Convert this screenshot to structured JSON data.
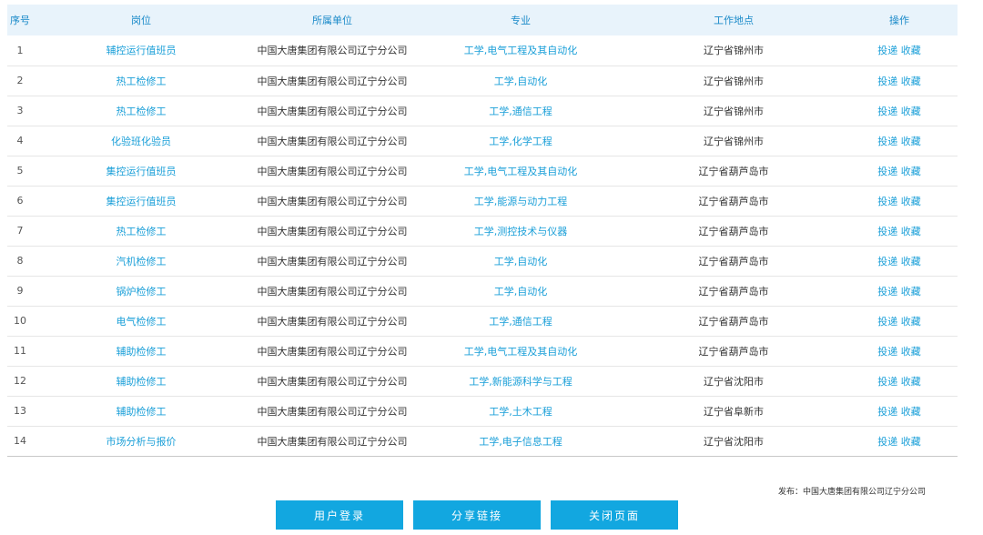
{
  "table": {
    "headers": [
      "序号",
      "岗位",
      "所属单位",
      "专业",
      "工作地点",
      "操作"
    ],
    "rows": [
      {
        "no": "1",
        "position": "辅控运行值班员",
        "unit": "中国大唐集团有限公司辽宁分公司",
        "major": "工学,电气工程及其自动化",
        "location": "辽宁省锦州市"
      },
      {
        "no": "2",
        "position": "热工检修工",
        "unit": "中国大唐集团有限公司辽宁分公司",
        "major": "工学,自动化",
        "location": "辽宁省锦州市"
      },
      {
        "no": "3",
        "position": "热工检修工",
        "unit": "中国大唐集团有限公司辽宁分公司",
        "major": "工学,通信工程",
        "location": "辽宁省锦州市"
      },
      {
        "no": "4",
        "position": "化验班化验员",
        "unit": "中国大唐集团有限公司辽宁分公司",
        "major": "工学,化学工程",
        "location": "辽宁省锦州市"
      },
      {
        "no": "5",
        "position": "集控运行值班员",
        "unit": "中国大唐集团有限公司辽宁分公司",
        "major": "工学,电气工程及其自动化",
        "location": "辽宁省葫芦岛市"
      },
      {
        "no": "6",
        "position": "集控运行值班员",
        "unit": "中国大唐集团有限公司辽宁分公司",
        "major": "工学,能源与动力工程",
        "location": "辽宁省葫芦岛市"
      },
      {
        "no": "7",
        "position": "热工检修工",
        "unit": "中国大唐集团有限公司辽宁分公司",
        "major": "工学,测控技术与仪器",
        "location": "辽宁省葫芦岛市"
      },
      {
        "no": "8",
        "position": "汽机检修工",
        "unit": "中国大唐集团有限公司辽宁分公司",
        "major": "工学,自动化",
        "location": "辽宁省葫芦岛市"
      },
      {
        "no": "9",
        "position": "锅炉检修工",
        "unit": "中国大唐集团有限公司辽宁分公司",
        "major": "工学,自动化",
        "location": "辽宁省葫芦岛市"
      },
      {
        "no": "10",
        "position": "电气检修工",
        "unit": "中国大唐集团有限公司辽宁分公司",
        "major": "工学,通信工程",
        "location": "辽宁省葫芦岛市"
      },
      {
        "no": "11",
        "position": "辅助检修工",
        "unit": "中国大唐集团有限公司辽宁分公司",
        "major": "工学,电气工程及其自动化",
        "location": "辽宁省葫芦岛市"
      },
      {
        "no": "12",
        "position": "辅助检修工",
        "unit": "中国大唐集团有限公司辽宁分公司",
        "major": "工学,新能源科学与工程",
        "location": "辽宁省沈阳市"
      },
      {
        "no": "13",
        "position": "辅助检修工",
        "unit": "中国大唐集团有限公司辽宁分公司",
        "major": "工学,土木工程",
        "location": "辽宁省阜新市"
      },
      {
        "no": "14",
        "position": "市场分析与报价",
        "unit": "中国大唐集团有限公司辽宁分公司",
        "major": "工学,电子信息工程",
        "location": "辽宁省沈阳市"
      }
    ],
    "action_apply": "投递",
    "action_favorite": "收藏"
  },
  "publisher": "发布：中国大唐集团有限公司辽宁分公司",
  "buttons": {
    "login": "用户登录",
    "share": "分享链接",
    "close": "关闭页面"
  },
  "colors": {
    "accent": "#1a9fd8",
    "header_bg": "#e8f3fb",
    "button_bg": "#12a7e0"
  }
}
